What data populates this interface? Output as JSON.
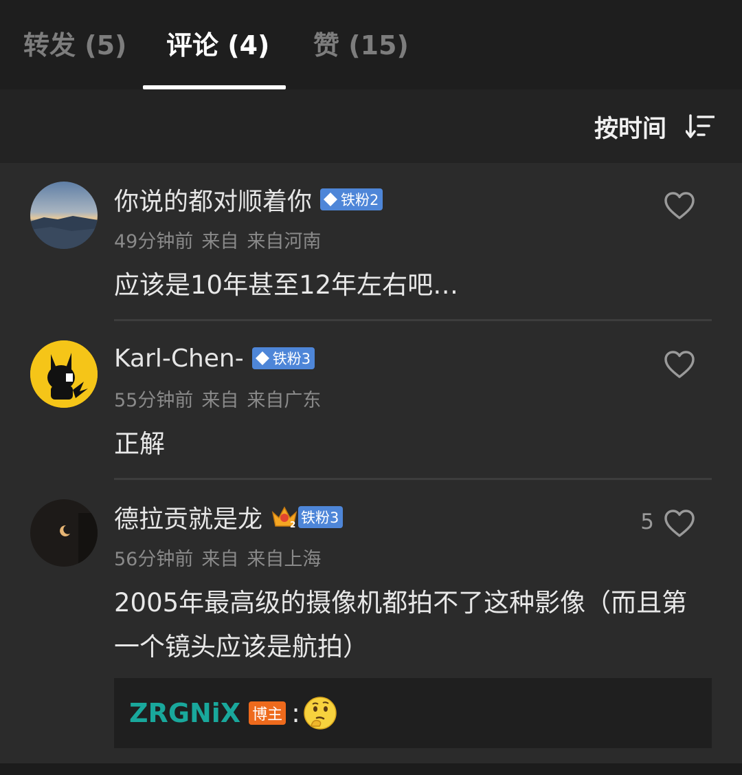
{
  "tabs": [
    {
      "label": "转发 (5)"
    },
    {
      "label": "评论 (4)"
    },
    {
      "label": "赞 (15)"
    }
  ],
  "sort": {
    "label": "按时间",
    "icon": "sort-descending-icon"
  },
  "comments": [
    {
      "name": "你说的都对顺着你",
      "badge": "铁粉2",
      "time": "49分钟前",
      "source": "来自",
      "location": "来自河南",
      "text": "应该是10年甚至12年左右吧…",
      "likes": ""
    },
    {
      "name": "Karl-Chen-",
      "badge": "铁粉3",
      "time": "55分钟前",
      "source": "来自",
      "location": "来自广东",
      "text": "正解",
      "likes": ""
    },
    {
      "name": "德拉贡就是龙",
      "badge": "铁粉3",
      "time": "56分钟前",
      "source": "来自",
      "location": "来自上海",
      "text": "2005年最高级的摄像机都拍不了这种影像（而且第一个镜头应该是航拍）",
      "likes": "5"
    }
  ],
  "reply": {
    "author": "ZRGNiX",
    "tag": "博主",
    "separator": ":"
  },
  "colors": {
    "badge_blue": "#4e86d8",
    "author_teal": "#19a89c",
    "author_tag_orange": "#ee6a1c"
  }
}
